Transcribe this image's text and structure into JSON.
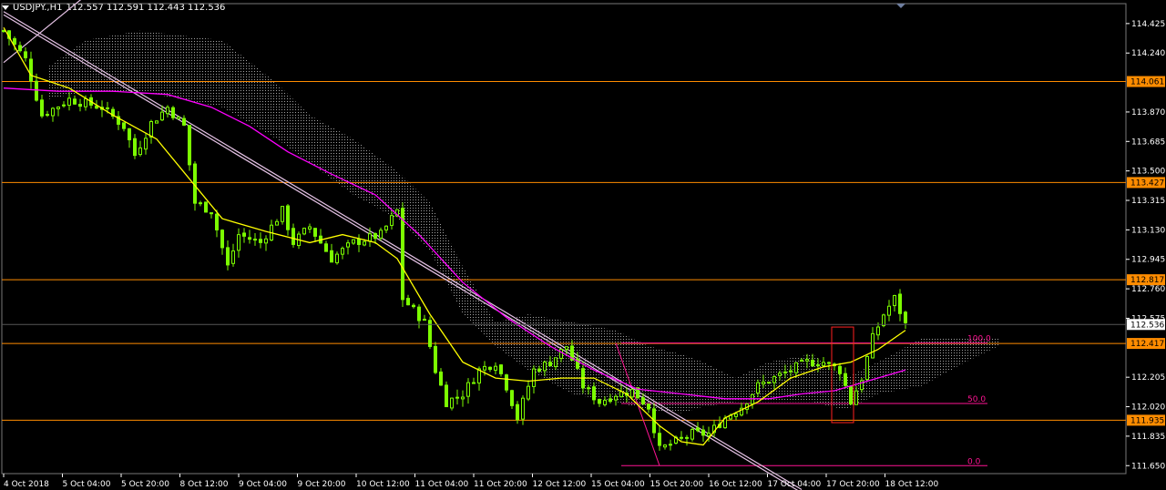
{
  "header": {
    "symbol": "USDJPY.,H1",
    "ohlc": "112.557 112.591 112.443 112.536"
  },
  "colors": {
    "background": "#000000",
    "bull": "#7CFC00",
    "bear": "#7CFC00",
    "ma_fast": "#FFFF00",
    "ma_slow": "#FF00FF",
    "level": "#FF8C00",
    "fib": "#FF1493",
    "cloud": "#BFBFBF",
    "trendline": "#E6C3E6",
    "axis_text": "#FFFFFF"
  },
  "chart_data": {
    "type": "candlestick",
    "symbol": "USDJPY.,H1",
    "timeframe": "H1",
    "ylim": [
      111.6,
      114.55
    ],
    "y_ticks": [
      114.425,
      114.24,
      113.87,
      113.685,
      113.5,
      113.315,
      113.13,
      112.945,
      112.76,
      112.575,
      112.205,
      112.02,
      111.835,
      111.65
    ],
    "x_ticks": [
      "4 Oct 2018",
      "5 Oct 04:00",
      "5 Oct 20:00",
      "8 Oct 12:00",
      "9 Oct 04:00",
      "9 Oct 20:00",
      "10 Oct 12:00",
      "11 Oct 04:00",
      "11 Oct 20:00",
      "12 Oct 12:00",
      "15 Oct 04:00",
      "15 Oct 20:00",
      "16 Oct 12:00",
      "17 Oct 04:00",
      "17 Oct 20:00",
      "18 Oct 12:00"
    ],
    "bar_count": 166,
    "current_price": 112.536,
    "close_anchors": [
      [
        0,
        114.38
      ],
      [
        4,
        114.2
      ],
      [
        7,
        113.85
      ],
      [
        12,
        113.95
      ],
      [
        18,
        113.9
      ],
      [
        22,
        113.78
      ],
      [
        24,
        113.6
      ],
      [
        27,
        113.8
      ],
      [
        30,
        113.9
      ],
      [
        33,
        113.78
      ],
      [
        35,
        113.3
      ],
      [
        38,
        113.25
      ],
      [
        41,
        112.9
      ],
      [
        43,
        113.1
      ],
      [
        47,
        113.05
      ],
      [
        51,
        113.25
      ],
      [
        53,
        113.05
      ],
      [
        56,
        113.15
      ],
      [
        60,
        112.95
      ],
      [
        64,
        113.05
      ],
      [
        69,
        113.1
      ],
      [
        72,
        113.25
      ],
      [
        73,
        112.7
      ],
      [
        77,
        112.55
      ],
      [
        79,
        112.25
      ],
      [
        81,
        112.05
      ],
      [
        84,
        112.1
      ],
      [
        87,
        112.25
      ],
      [
        90,
        112.3
      ],
      [
        92,
        112.15
      ],
      [
        94,
        111.95
      ],
      [
        97,
        112.25
      ],
      [
        100,
        112.3
      ],
      [
        103,
        112.4
      ],
      [
        106,
        112.15
      ],
      [
        109,
        112.05
      ],
      [
        112,
        112.1
      ],
      [
        115,
        112.12
      ],
      [
        118,
        112.02
      ],
      [
        120,
        111.75
      ],
      [
        123,
        111.8
      ],
      [
        126,
        111.85
      ],
      [
        129,
        111.85
      ],
      [
        132,
        111.95
      ],
      [
        135,
        112.02
      ],
      [
        138,
        112.15
      ],
      [
        141,
        112.2
      ],
      [
        144,
        112.25
      ],
      [
        147,
        112.3
      ],
      [
        150,
        112.3
      ],
      [
        153,
        112.25
      ],
      [
        155,
        112.05
      ],
      [
        157,
        112.2
      ],
      [
        159,
        112.45
      ],
      [
        161,
        112.6
      ],
      [
        163,
        112.7
      ],
      [
        165,
        112.536
      ]
    ],
    "ma_fast": [
      [
        0,
        114.4
      ],
      [
        5,
        114.1
      ],
      [
        12,
        114.02
      ],
      [
        20,
        113.85
      ],
      [
        28,
        113.7
      ],
      [
        34,
        113.45
      ],
      [
        40,
        113.2
      ],
      [
        48,
        113.12
      ],
      [
        56,
        113.05
      ],
      [
        62,
        113.1
      ],
      [
        68,
        113.05
      ],
      [
        72,
        112.95
      ],
      [
        78,
        112.6
      ],
      [
        84,
        112.3
      ],
      [
        90,
        112.2
      ],
      [
        96,
        112.18
      ],
      [
        102,
        112.2
      ],
      [
        108,
        112.2
      ],
      [
        114,
        112.1
      ],
      [
        120,
        111.9
      ],
      [
        124,
        111.8
      ],
      [
        128,
        111.78
      ],
      [
        132,
        111.95
      ],
      [
        138,
        112.05
      ],
      [
        144,
        112.2
      ],
      [
        150,
        112.27
      ],
      [
        155,
        112.3
      ],
      [
        160,
        112.38
      ],
      [
        165,
        112.5
      ]
    ],
    "ma_slow": [
      [
        0,
        114.02
      ],
      [
        10,
        114.0
      ],
      [
        20,
        114.0
      ],
      [
        30,
        113.98
      ],
      [
        38,
        113.9
      ],
      [
        45,
        113.78
      ],
      [
        52,
        113.62
      ],
      [
        60,
        113.48
      ],
      [
        68,
        113.35
      ],
      [
        76,
        113.1
      ],
      [
        84,
        112.8
      ],
      [
        92,
        112.58
      ],
      [
        100,
        112.4
      ],
      [
        108,
        112.25
      ],
      [
        116,
        112.13
      ],
      [
        124,
        112.1
      ],
      [
        132,
        112.07
      ],
      [
        140,
        112.07
      ],
      [
        146,
        112.1
      ],
      [
        152,
        112.12
      ],
      [
        158,
        112.18
      ],
      [
        165,
        112.25
      ]
    ],
    "cloud_top": [
      [
        8,
        114.15
      ],
      [
        15,
        114.32
      ],
      [
        25,
        114.38
      ],
      [
        40,
        114.32
      ],
      [
        50,
        114.05
      ],
      [
        56,
        113.85
      ],
      [
        64,
        113.7
      ],
      [
        72,
        113.5
      ],
      [
        78,
        113.3
      ],
      [
        84,
        112.9
      ],
      [
        90,
        112.55
      ],
      [
        96,
        112.6
      ],
      [
        104,
        112.55
      ],
      [
        112,
        112.5
      ],
      [
        118,
        112.4
      ],
      [
        124,
        112.35
      ],
      [
        128,
        112.3
      ],
      [
        134,
        112.2
      ],
      [
        140,
        112.3
      ],
      [
        148,
        112.35
      ],
      [
        154,
        112.2
      ],
      [
        160,
        112.3
      ],
      [
        168,
        112.45
      ],
      [
        176,
        112.45
      ],
      [
        182,
        112.45
      ]
    ],
    "cloud_bottom": [
      [
        8,
        113.95
      ],
      [
        15,
        114.0
      ],
      [
        25,
        114.0
      ],
      [
        40,
        113.9
      ],
      [
        50,
        113.7
      ],
      [
        56,
        113.55
      ],
      [
        64,
        113.35
      ],
      [
        72,
        113.2
      ],
      [
        78,
        113.0
      ],
      [
        84,
        112.6
      ],
      [
        90,
        112.4
      ],
      [
        96,
        112.25
      ],
      [
        104,
        112.1
      ],
      [
        112,
        112.05
      ],
      [
        118,
        112.0
      ],
      [
        124,
        111.98
      ],
      [
        128,
        112.02
      ],
      [
        134,
        112.05
      ],
      [
        140,
        112.05
      ],
      [
        148,
        112.05
      ],
      [
        154,
        112.0
      ],
      [
        160,
        112.1
      ],
      [
        168,
        112.15
      ],
      [
        176,
        112.3
      ],
      [
        182,
        112.4
      ]
    ],
    "horizontal_levels": [
      114.061,
      113.427,
      112.817,
      112.417,
      111.935
    ],
    "level_labels": [
      "114.061",
      "113.427",
      "112.817",
      "112.417",
      "111.935"
    ],
    "fibonacci": {
      "high": 112.42,
      "low": 111.65,
      "start_bar": 113,
      "end_bar": 180,
      "levels": [
        {
          "label": "100.0",
          "price": 112.42
        },
        {
          "label": "50.0",
          "price": 112.04
        },
        {
          "label": "0.0",
          "price": 111.65
        }
      ],
      "swing_line": [
        [
          112,
          112.42
        ],
        [
          120,
          111.65
        ]
      ]
    },
    "trendlines": [
      {
        "from": [
          0,
          114.5
        ],
        "to": [
          146,
          111.5
        ]
      },
      {
        "from": [
          0,
          114.48
        ],
        "to": [
          146,
          111.48
        ]
      },
      {
        "from": [
          0,
          114.18
        ],
        "to": [
          15,
          114.6
        ]
      }
    ],
    "marker_box": {
      "from_bar": 152,
      "to_bar": 155,
      "high": 112.52,
      "low": 111.92
    }
  }
}
